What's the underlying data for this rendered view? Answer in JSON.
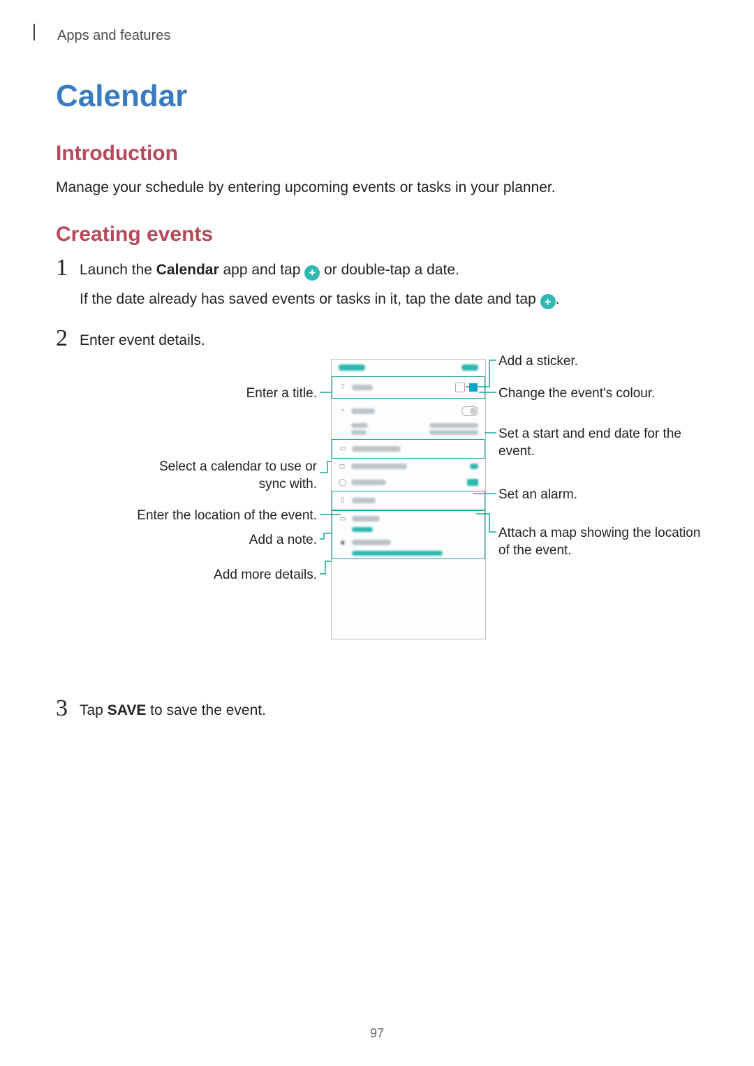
{
  "header": "Apps and features",
  "title": "Calendar",
  "section_intro": "Introduction",
  "intro_text": "Manage your schedule by entering upcoming events or tasks in your planner.",
  "section_create": "Creating events",
  "step1_a": "Launch the ",
  "step1_bold": "Calendar",
  "step1_b": " app and tap ",
  "step1_c": " or double-tap a date.",
  "step1_note": "If the date already has saved events or tasks in it, tap the date and tap ",
  "step1_note_end": ".",
  "step2": "Enter event details.",
  "step3_a": "Tap ",
  "step3_bold": "SAVE",
  "step3_b": " to save the event.",
  "callouts": {
    "left": {
      "title": "Enter a title.",
      "calendar": "Select a calendar to use or sync with.",
      "location": "Enter the location of the event.",
      "note": "Add a note.",
      "details": "Add more details."
    },
    "right": {
      "sticker": "Add a sticker.",
      "colour": "Change the event's colour.",
      "dates": "Set a start and end date for the event.",
      "alarm": "Set an alarm.",
      "map": "Attach a map showing the location of the event."
    }
  },
  "page_number": "97"
}
